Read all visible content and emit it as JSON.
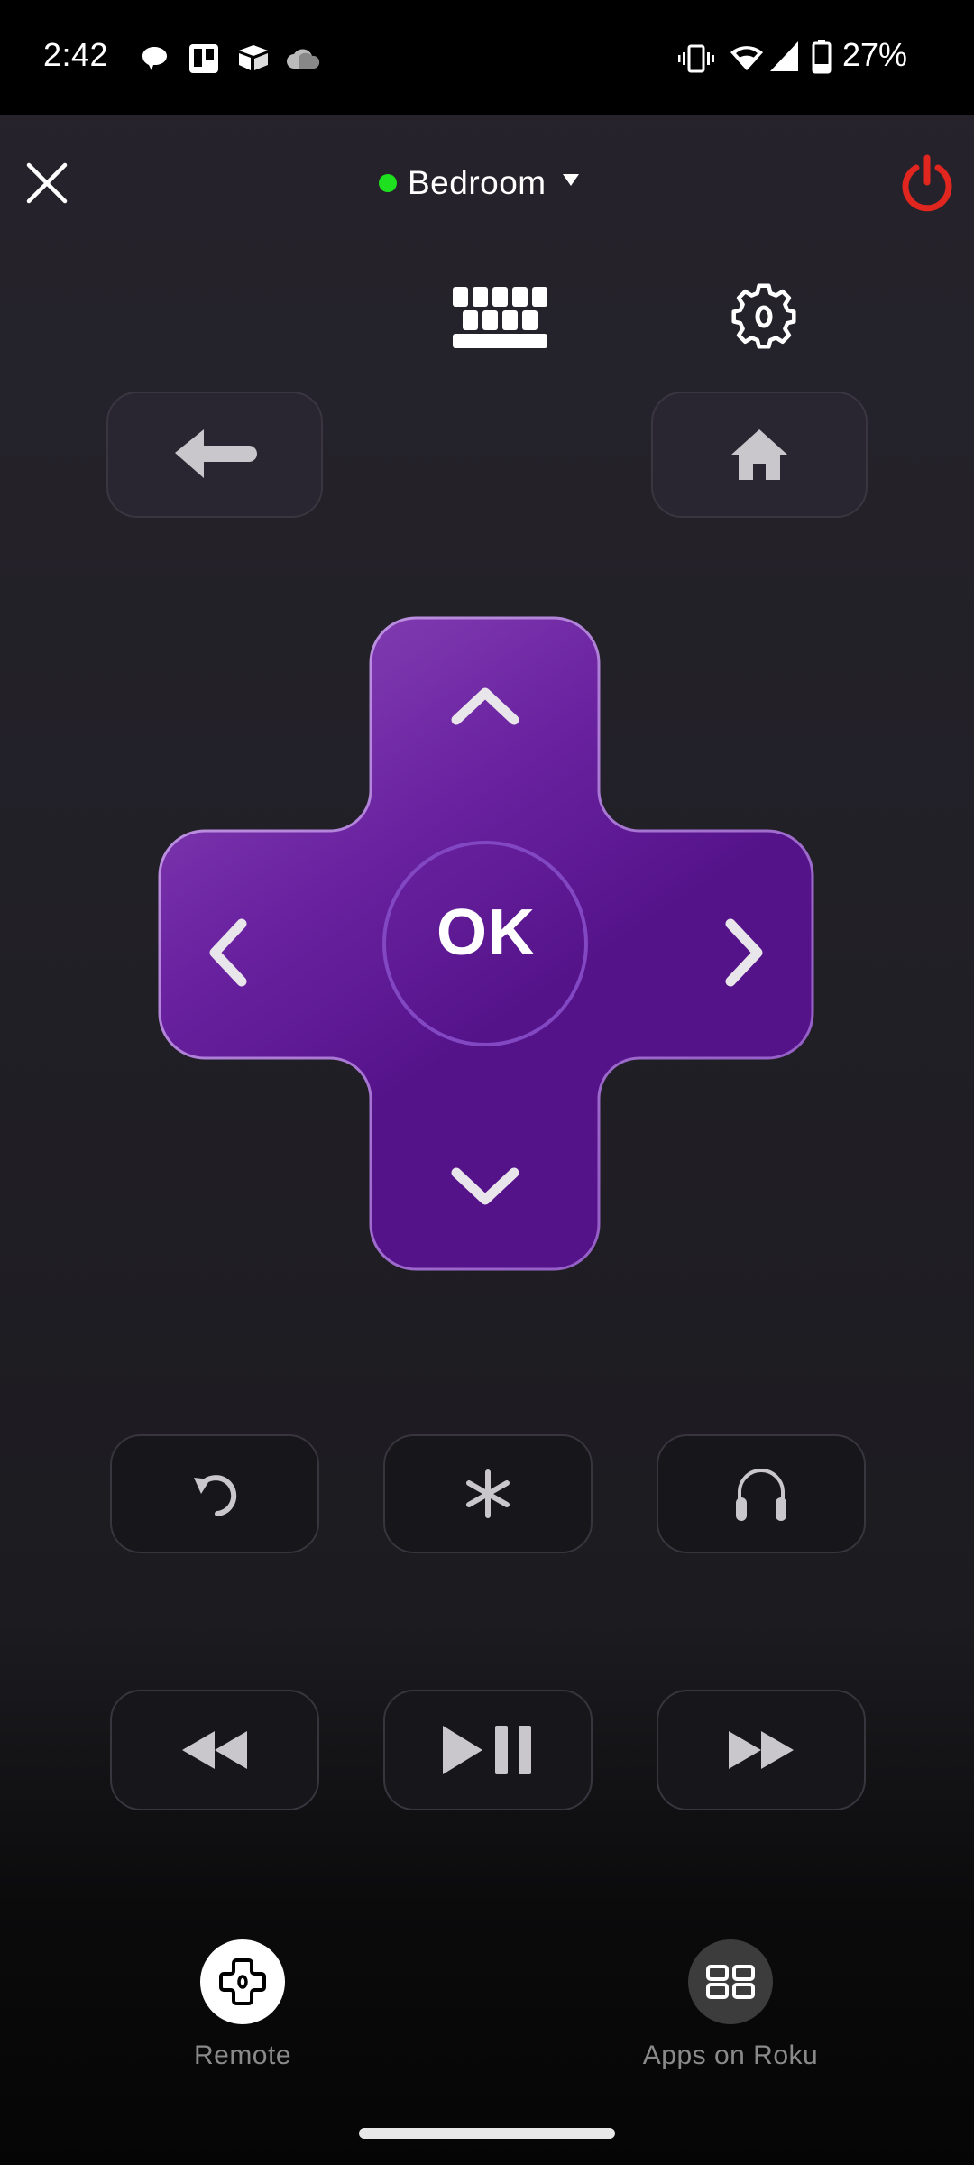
{
  "status_bar": {
    "time": "2:42",
    "notification_icons": [
      "chat-bubble-icon",
      "trello-icon",
      "airtable-icon",
      "onedrive-cloud-icon"
    ],
    "system_icons": [
      "vibrate-icon",
      "wifi-icon",
      "cellular-signal-icon",
      "battery-icon"
    ],
    "battery_percent": "27%"
  },
  "header": {
    "close_icon": "close-icon",
    "device_name": "Bedroom",
    "device_status_color": "#1fe01f",
    "device_dropdown_icon": "caret-down-icon",
    "power_icon": "power-icon",
    "power_color": "#e0261f"
  },
  "toolbar": {
    "keyboard_icon": "keyboard-icon",
    "settings_icon": "gear-icon"
  },
  "nav_buttons": {
    "back_icon": "back-arrow-icon",
    "home_icon": "home-icon"
  },
  "dpad": {
    "ok_label": "OK",
    "accent_color": "#56138a",
    "highlight_color": "#8642b5",
    "directions": [
      "up",
      "down",
      "left",
      "right"
    ]
  },
  "function_buttons": [
    {
      "id": "replay",
      "icon": "replay-icon"
    },
    {
      "id": "options",
      "icon": "asterisk-icon"
    },
    {
      "id": "private-listening",
      "icon": "headphones-icon"
    }
  ],
  "media_buttons": [
    {
      "id": "rewind",
      "icon": "rewind-icon"
    },
    {
      "id": "play-pause",
      "icon": "play-pause-icon"
    },
    {
      "id": "fast-forward",
      "icon": "fast-forward-icon"
    }
  ],
  "bottom_nav": {
    "items": [
      {
        "label": "Remote",
        "icon": "dpad-icon",
        "active": true
      },
      {
        "label": "Apps on Roku",
        "icon": "apps-grid-icon",
        "active": false
      }
    ]
  }
}
